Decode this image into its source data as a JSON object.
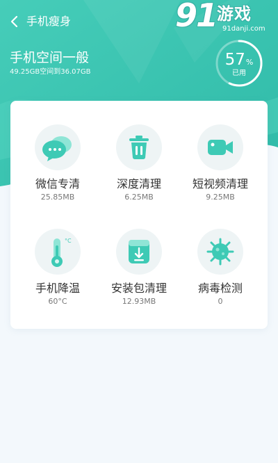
{
  "nav": {
    "title": "手机瘦身"
  },
  "watermark": {
    "logo_number": "91",
    "logo_text": "游戏",
    "domain": "91danji.com"
  },
  "storage": {
    "status_title": "手机空间一般",
    "detail": "49.25GB空间到36.07GB",
    "usage_percent": "57",
    "usage_unit": "%",
    "usage_label": "已用",
    "usage_fraction": 0.57
  },
  "tools": [
    {
      "name": "微信专清",
      "value": "25.85MB",
      "icon": "wechat-icon"
    },
    {
      "name": "深度清理",
      "value": "6.25MB",
      "icon": "trash-icon"
    },
    {
      "name": "短视频清理",
      "value": "9.25MB",
      "icon": "video-camera-icon"
    },
    {
      "name": "手机降温",
      "value": "60°C",
      "icon": "thermometer-icon"
    },
    {
      "name": "安装包清理",
      "value": "12.93MB",
      "icon": "install-package-icon"
    },
    {
      "name": "病毒检测",
      "value": "0",
      "icon": "virus-icon"
    }
  ],
  "colors": {
    "accent": "#3cc8b4",
    "accent_light": "#70d8c8",
    "card_bg": "#ffffff",
    "page_bg": "#f3f8fc"
  }
}
